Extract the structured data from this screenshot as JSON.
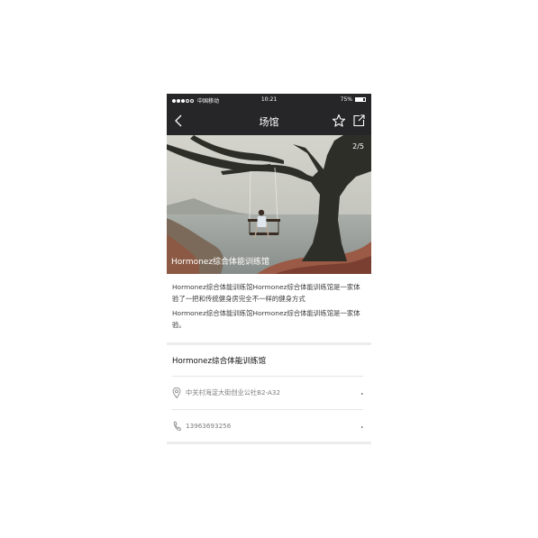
{
  "status_bar": {
    "carrier": "中国移动",
    "time": "10:21",
    "battery": "75%",
    "battery_level": 0.75
  },
  "nav": {
    "title": "场馆",
    "back_icon": "chevron-left-icon",
    "favorite_icon": "star-icon",
    "share_icon": "share-icon"
  },
  "gallery": {
    "counter": "2/5",
    "current": 2,
    "total": 5,
    "caption": "Hormonez综合体能训练馆"
  },
  "description": {
    "paragraphs": [
      "Hormonez综合体能训练馆Hormonez综合体能训练馆是一家体验了一把和传统健身房完全不一样的健身方式",
      "Hormonez综合体能训练馆Hormonez综合体能训练馆是一家体验。"
    ]
  },
  "venue": {
    "name": "Hormonez综合体能训练馆",
    "address": "中关村海淀大街创业公社B2-A32",
    "phone": "13963693256"
  }
}
